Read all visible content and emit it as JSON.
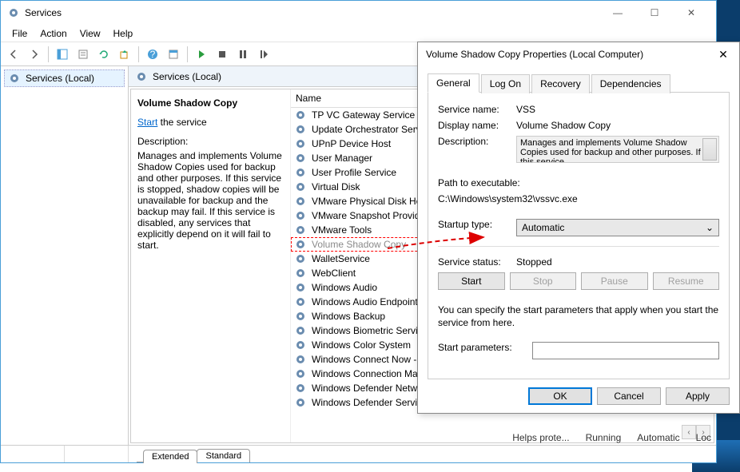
{
  "window": {
    "title": "Services",
    "menus": [
      "File",
      "Action",
      "View",
      "Help"
    ],
    "left_panel_item": "Services (Local)",
    "right_header": "Services (Local)",
    "bottom_tabs": {
      "extended": "Extended",
      "standard": "Standard"
    }
  },
  "detail": {
    "title": "Volume Shadow Copy",
    "start_link": "Start",
    "start_suffix": " the service",
    "desc_label": "Description:",
    "description": "Manages and implements Volume Shadow Copies used for backup and other purposes. If this service is stopped, shadow copies will be unavailable for backup and the backup may fail. If this service is disabled, any services that explicitly depend on it will fail to start."
  },
  "list": {
    "header": "Name",
    "items": [
      "TP VC Gateway Service",
      "Update Orchestrator Service",
      "UPnP Device Host",
      "User Manager",
      "User Profile Service",
      "Virtual Disk",
      "VMware Physical Disk Help...",
      "VMware Snapshot Provider",
      "VMware Tools",
      "Volume Shadow Copy",
      "WalletService",
      "WebClient",
      "Windows Audio",
      "Windows Audio Endpoint B...",
      "Windows Backup",
      "Windows Biometric Service",
      "Windows Color System",
      "Windows Connect Now - C...",
      "Windows Connection Mana...",
      "Windows Defender Networ...",
      "Windows Defender Service"
    ],
    "selected_index": 9,
    "bottom_frag": {
      "c1": "Helps prote...",
      "c2": "Running",
      "c3": "Automatic",
      "c4": "Loc"
    }
  },
  "dialog": {
    "title": "Volume Shadow Copy Properties (Local Computer)",
    "tabs": [
      "General",
      "Log On",
      "Recovery",
      "Dependencies"
    ],
    "labels": {
      "service_name": "Service name:",
      "display_name": "Display name:",
      "description": "Description:",
      "path": "Path to executable:",
      "startup": "Startup type:",
      "status": "Service status:",
      "start_params_hint": "You can specify the start parameters that apply when you start the service from here.",
      "start_params": "Start parameters:"
    },
    "values": {
      "service_name": "VSS",
      "display_name": "Volume Shadow Copy",
      "description": "Manages and implements Volume Shadow Copies used for backup and other purposes. If this service",
      "path": "C:\\Windows\\system32\\vssvc.exe",
      "startup": "Automatic",
      "status": "Stopped"
    },
    "buttons": {
      "start": "Start",
      "stop": "Stop",
      "pause": "Pause",
      "resume": "Resume",
      "ok": "OK",
      "cancel": "Cancel",
      "apply": "Apply"
    }
  }
}
